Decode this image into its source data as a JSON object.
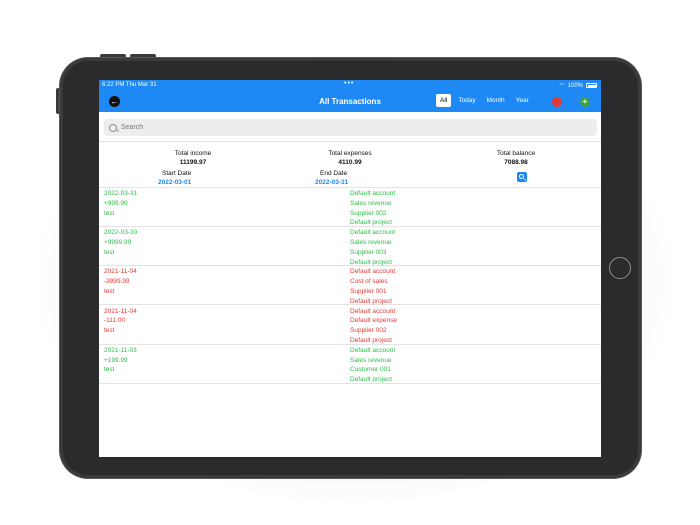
{
  "status_bar": {
    "time": "6:22 PM  Thu Mar 31",
    "battery": "100%"
  },
  "header": {
    "title": "All Transactions",
    "segments": [
      "All",
      "Today",
      "Month",
      "Year"
    ],
    "active_segment": "All"
  },
  "search": {
    "placeholder": "Search"
  },
  "summary": {
    "income_label": "Total income",
    "income_value": "11199.97",
    "expenses_label": "Total expenses",
    "expenses_value": "4110.99",
    "balance_label": "Total balance",
    "balance_value": "7088.98",
    "start_label": "Start Date",
    "start_value": "2022-03-01",
    "end_label": "End Date",
    "end_value": "2022-03-31"
  },
  "transactions": [
    {
      "date": "2022-03-31",
      "amount": "+999.99",
      "note": "test",
      "account": "Default account",
      "category": "Sales revenue",
      "party": "Supplier 002",
      "project": "Default project",
      "type": "income"
    },
    {
      "date": "2022-03-30",
      "amount": "+9999.99",
      "note": "test",
      "account": "Default account",
      "category": "Sales revenue",
      "party": "Supplier 003",
      "project": "Default project",
      "type": "income"
    },
    {
      "date": "2021-11-04",
      "amount": "-3999.99",
      "note": "test",
      "account": "Default account",
      "category": "Cost of sales",
      "party": "Supplier 001",
      "project": "Default project",
      "type": "expense"
    },
    {
      "date": "2021-11-04",
      "amount": "-111.00",
      "note": "test",
      "account": "Default account",
      "category": "Default expense",
      "party": "Supplier 002",
      "project": "Default project",
      "type": "expense"
    },
    {
      "date": "2021-11-03",
      "amount": "+199.99",
      "note": "test",
      "account": "Default account",
      "category": "Sales revenue",
      "party": "Customer 001",
      "project": "Default project",
      "type": "income"
    }
  ],
  "colors": {
    "accent": "#1e88f5",
    "income": "#2ebd48",
    "expense": "#e53935"
  },
  "icons": {
    "back": "arrow-left-icon",
    "delete": "red-circle-icon",
    "add": "plus-circle-icon",
    "filter": "search-icon"
  }
}
